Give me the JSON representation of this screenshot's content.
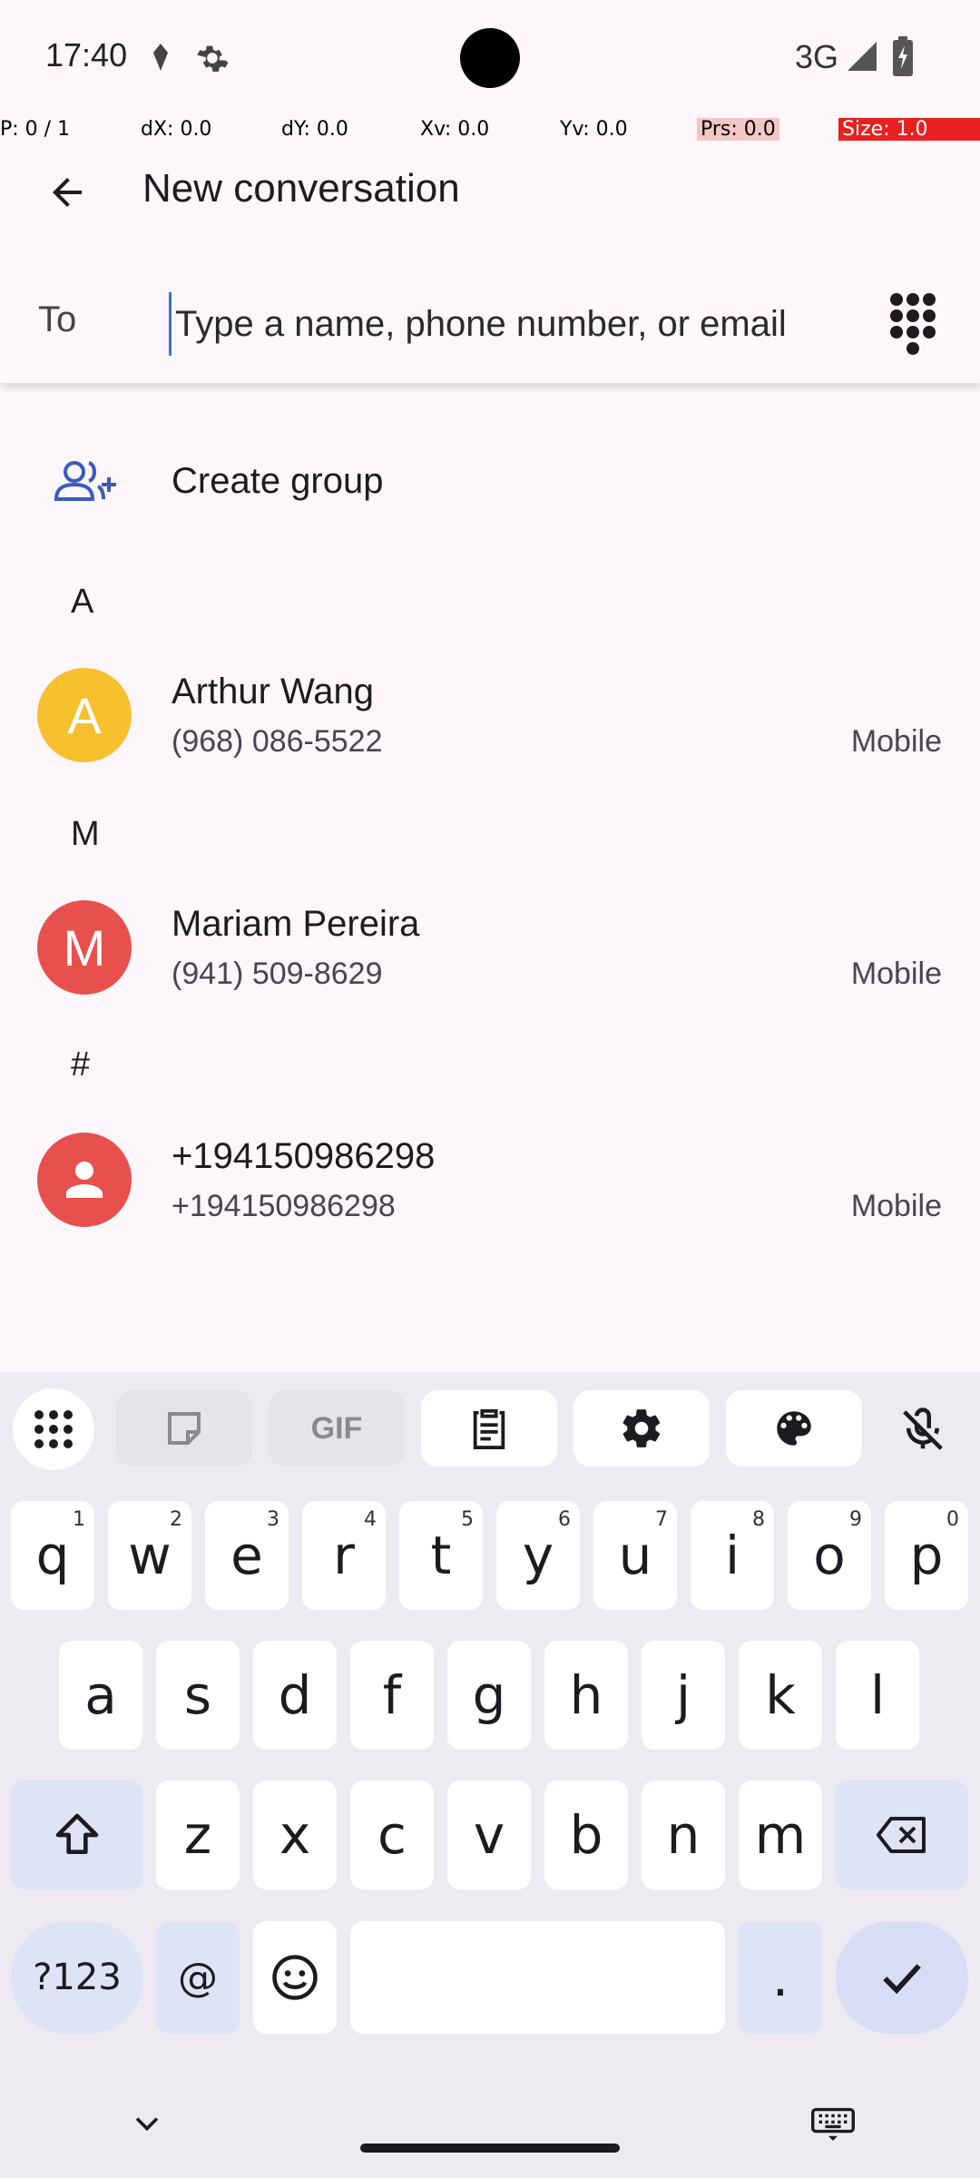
{
  "status_bar": {
    "time": "17:40",
    "network": "3G"
  },
  "debug_overlay": {
    "p": "P: 0 / 1",
    "dx": "dX: 0.0",
    "dy": "dY: 0.0",
    "xv": "Xv: 0.0",
    "yv": "Yv: 0.0",
    "prs": "Prs: 0.0",
    "size": "Size: 1.0"
  },
  "app_bar": {
    "title": "New conversation"
  },
  "to_row": {
    "label": "To",
    "placeholder": "Type a name, phone number, or email"
  },
  "create_group": {
    "label": "Create group"
  },
  "sections": [
    {
      "header": "A",
      "contacts": [
        {
          "initial": "A",
          "name": "Arthur Wang",
          "phone": "(968) 086-5522",
          "type": "Mobile",
          "color": "#f6c02e"
        }
      ]
    },
    {
      "header": "M",
      "contacts": [
        {
          "initial": "M",
          "name": "Mariam Pereira",
          "phone": "(941) 509-8629",
          "type": "Mobile",
          "color": "#e8504d"
        }
      ]
    },
    {
      "header": "#",
      "contacts": [
        {
          "initial": "",
          "name": "+194150986298",
          "phone": "+194150986298",
          "type": "Mobile",
          "color": "#e8504d"
        }
      ]
    }
  ],
  "keyboard": {
    "row1": [
      "q",
      "w",
      "e",
      "r",
      "t",
      "y",
      "u",
      "i",
      "o",
      "p"
    ],
    "row1_hints": [
      "1",
      "2",
      "3",
      "4",
      "5",
      "6",
      "7",
      "8",
      "9",
      "0"
    ],
    "row2": [
      "a",
      "s",
      "d",
      "f",
      "g",
      "h",
      "j",
      "k",
      "l"
    ],
    "row3": [
      "z",
      "x",
      "c",
      "v",
      "b",
      "n",
      "m"
    ],
    "symbols_key": "?123",
    "at_key": "@",
    "period_key": ".",
    "gif_label": "GIF"
  },
  "colors": {
    "accent": "#3b6ee0",
    "keyboard_bg": "#eeeaf2",
    "special_key": "#dfe3f6"
  }
}
